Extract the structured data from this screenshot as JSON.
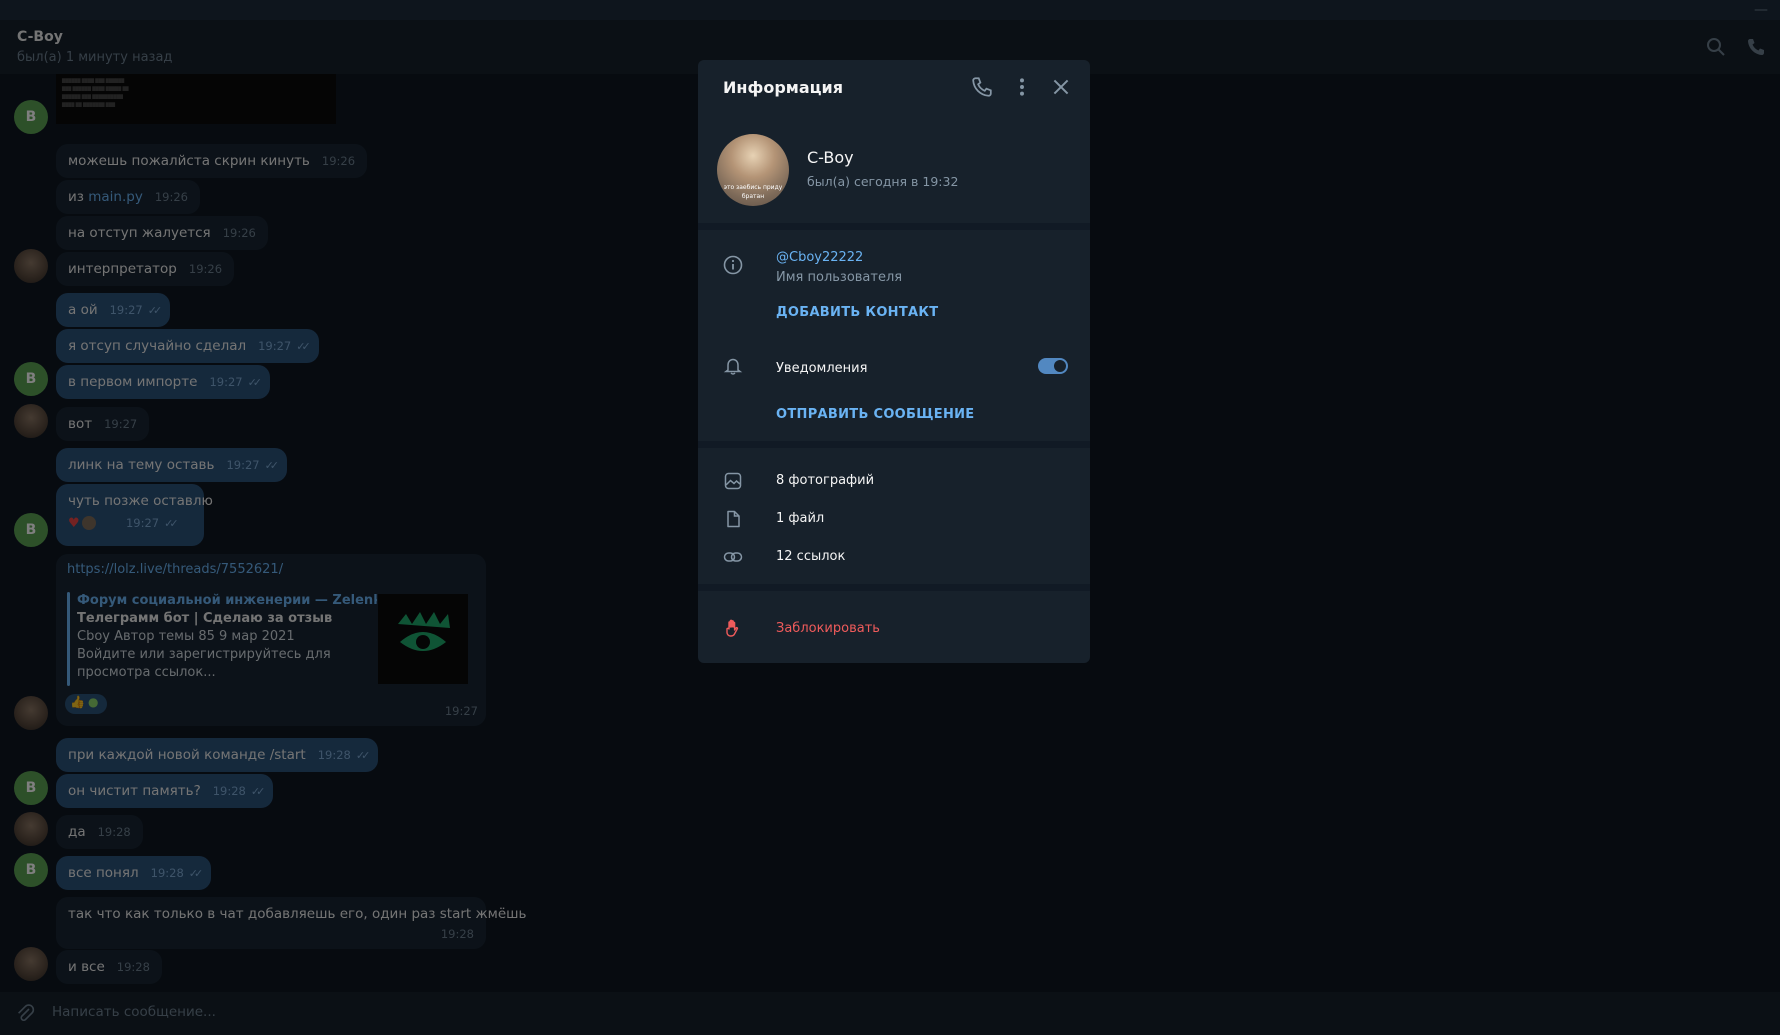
{
  "header": {
    "name": "C-Boy",
    "status": "был(а) 1 минуту назад"
  },
  "messages": [
    {
      "text": "можешь пожалйста скрин кинуть",
      "time": "19:26"
    },
    {
      "text_prefix": "из ",
      "link": "main.py",
      "time": "19:26"
    },
    {
      "text": "на отступ жалуется",
      "time": "19:26"
    },
    {
      "text": "интерпретатор",
      "time": "19:26"
    },
    {
      "text": "а ой",
      "time": "19:27"
    },
    {
      "text": "я отсуп случайно сделал",
      "time": "19:27"
    },
    {
      "text": "в первом импорте",
      "time": "19:27"
    },
    {
      "text": "вот",
      "time": "19:27"
    },
    {
      "text": "линк на тему оставь",
      "time": "19:27"
    },
    {
      "text": "чуть позже оставлю",
      "time": "19:27"
    },
    {
      "text": "при каждой новой команде /start",
      "time": "19:28"
    },
    {
      "text": "он чистит память?",
      "time": "19:28"
    },
    {
      "text": "да",
      "time": "19:28"
    },
    {
      "text": "все понял",
      "time": "19:28"
    },
    {
      "text": "так что как только в чат добавляешь его, один раз start жмёшь",
      "time": "19:28"
    },
    {
      "text": "и все",
      "time": "19:28"
    }
  ],
  "avatar_letter": "B",
  "link_preview": {
    "url": "https://lolz.live/threads/7552621/",
    "site": "Форум социальной инженерии — Zelenka....",
    "title": "Телеграмм бот | Сделаю за отзыв",
    "line1": "Cboy   Автор темы 85 9 мар 2021",
    "line2": "Войдите или зарегистрируйтесь для",
    "line3": "просмотра ссылок...",
    "time": "19:27"
  },
  "compose": {
    "placeholder": "Написать сообщение..."
  },
  "panel": {
    "title": "Информация",
    "name": "C-Boy",
    "status": "был(а) сегодня в 19:32",
    "username": "@Cboy22222",
    "username_label": "Имя пользователя",
    "add_contact": "ДОБАВИТЬ КОНТАКТ",
    "notifications": "Уведомления",
    "notifications_on": true,
    "send_message": "ОТПРАВИТЬ СООБЩЕНИЕ",
    "photos": "8 фотографий",
    "files": "1 файл",
    "links": "12 ссылок",
    "block": "Заблокировать",
    "avatar_caption_1": "это заебись приду",
    "avatar_caption_2": "братан"
  },
  "colors": {
    "accent": "#6ab3f3",
    "danger": "#ef5b5b",
    "bubble_out": "#2b5278",
    "bubble_in": "#182533",
    "toggle": "#5288c1"
  }
}
